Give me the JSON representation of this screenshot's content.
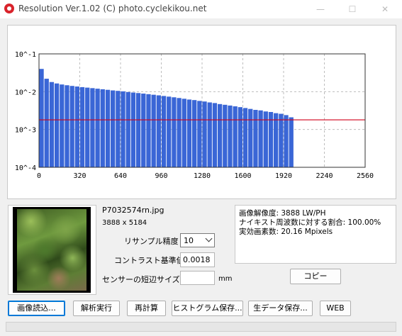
{
  "window": {
    "title": "Resolution Ver.1.02 (C) photo.cyclekikou.net",
    "controls": [
      "—",
      "☐",
      "✕"
    ]
  },
  "chart_data": {
    "type": "bar",
    "yscale": "log",
    "ylim": [
      0.0001,
      0.1
    ],
    "xlim": [
      0,
      2560
    ],
    "xticks": [
      0,
      320,
      640,
      960,
      1280,
      1600,
      1920,
      2240,
      2560
    ],
    "yticks": [
      "10^-4",
      "10^-3",
      "10^-2",
      "10^-1"
    ],
    "grid": true,
    "bar_color": "#3a66d6",
    "threshold_color": "#d0021b",
    "threshold": 0.0018,
    "bin_width": 40,
    "values": [
      0.04,
      0.022,
      0.018,
      0.0165,
      0.0155,
      0.0148,
      0.0142,
      0.0137,
      0.0132,
      0.0128,
      0.0124,
      0.012,
      0.0116,
      0.0112,
      0.0108,
      0.0105,
      0.0102,
      0.0098,
      0.0095,
      0.0092,
      0.0089,
      0.0086,
      0.0083,
      0.008,
      0.0077,
      0.0074,
      0.0071,
      0.0068,
      0.0065,
      0.0062,
      0.006,
      0.0057,
      0.0055,
      0.0052,
      0.005,
      0.0047,
      0.0045,
      0.0043,
      0.0041,
      0.0039,
      0.0037,
      0.0035,
      0.0033,
      0.0032,
      0.003,
      0.0029,
      0.0027,
      0.0026,
      0.0024,
      0.0021
    ]
  },
  "image": {
    "file_name": "P7032574rn.jpg",
    "dimensions": "3888 x 5184"
  },
  "settings": {
    "resample_label": "リサンプル精度",
    "resample_value": "10",
    "contrast_label": "コントラスト基準値",
    "contrast_value": "0.0018",
    "sensor_label": "センサーの短辺サイズ",
    "sensor_value": "",
    "sensor_unit": "mm"
  },
  "results": {
    "line1": "画像解像度: 3888 LW/PH",
    "line2": "ナイキスト周波数に対する割合: 100.00%",
    "line3": "実効画素数: 20.16 Mpixels"
  },
  "buttons": {
    "copy": "コピー",
    "load_image": "画像読込...",
    "analyze": "解析実行",
    "recalc": "再計算",
    "save_histogram": "ヒストグラム保存...",
    "save_raw": "生データ保存...",
    "web": "WEB"
  }
}
